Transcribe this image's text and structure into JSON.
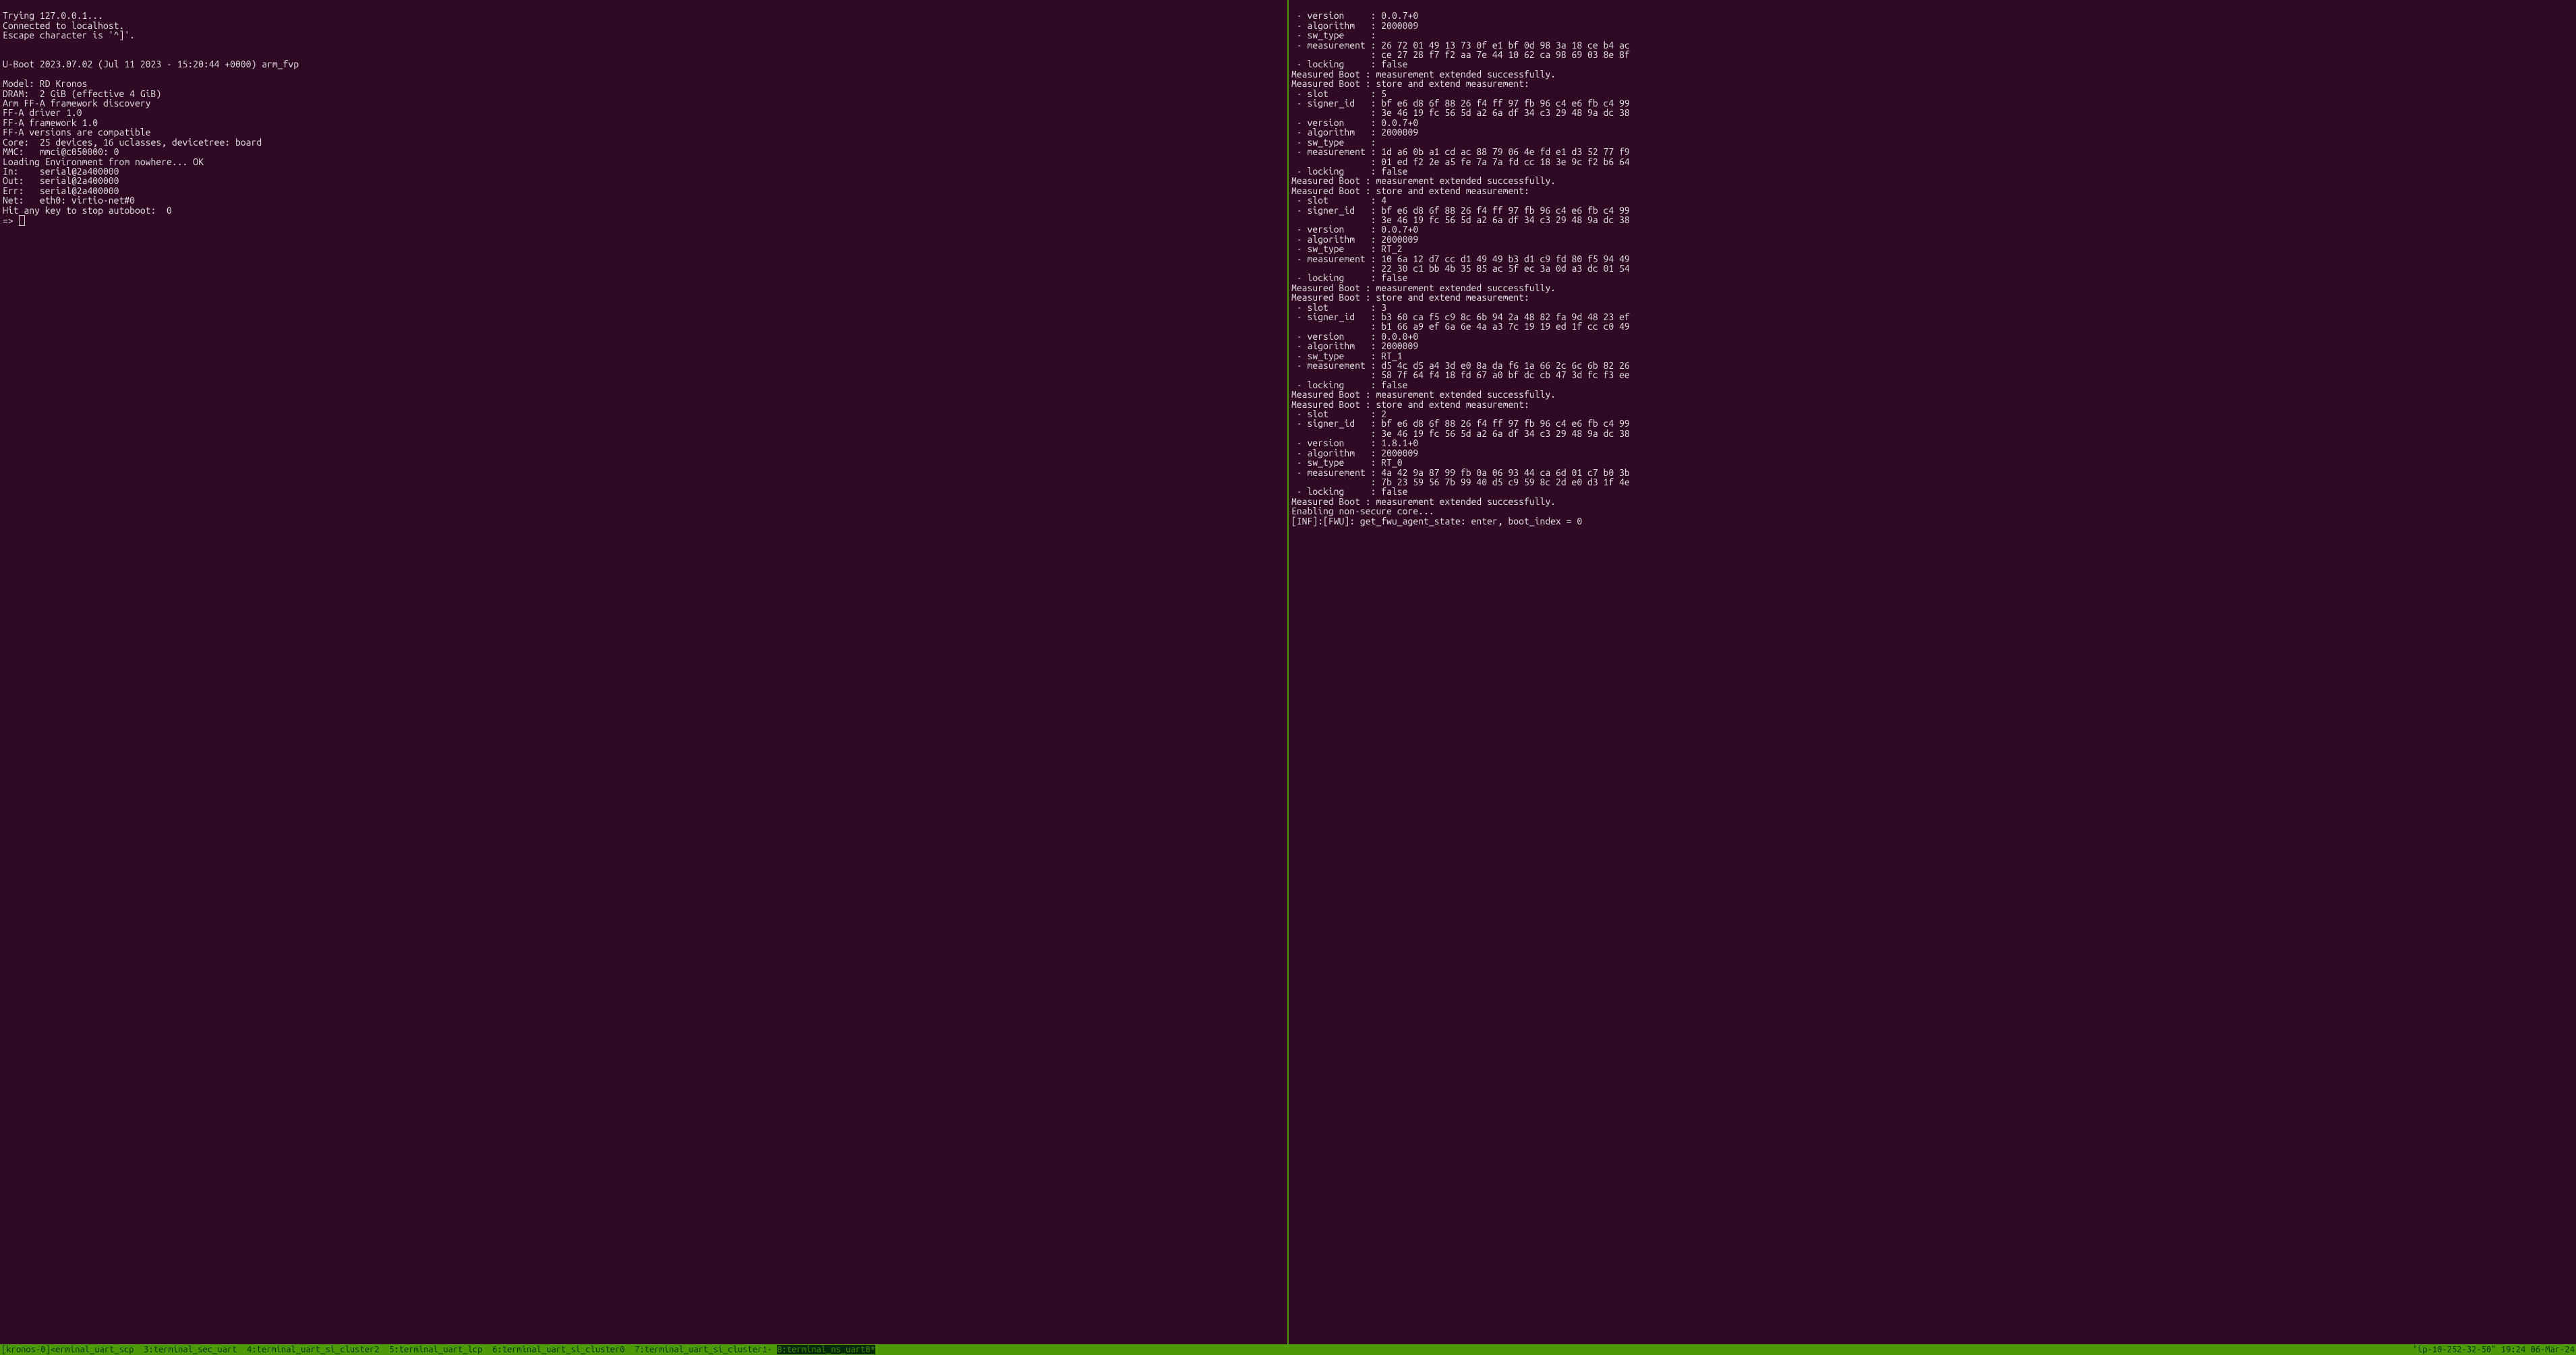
{
  "left_pane": {
    "lines": [
      "Trying 127.0.0.1...",
      "Connected to localhost.",
      "Escape character is '^]'.",
      "",
      "",
      "U-Boot 2023.07.02 (Jul 11 2023 - 15:20:44 +0000) arm_fvp",
      "",
      "Model: RD Kronos",
      "DRAM:  2 GiB (effective 4 GiB)",
      "Arm FF-A framework discovery",
      "FF-A driver 1.0",
      "FF-A framework 1.0",
      "FF-A versions are compatible",
      "Core:  25 devices, 16 uclasses, devicetree: board",
      "MMC:   mmci@c050000: 0",
      "Loading Environment from nowhere... OK",
      "In:    serial@2a400000",
      "Out:   serial@2a400000",
      "Err:   serial@2a400000",
      "Net:   eth0: virtio-net#0",
      "Hit any key to stop autoboot:  0"
    ],
    "prompt": "=> "
  },
  "right_pane": {
    "lines": [
      " - version     : 0.0.7+0",
      " - algorithm   : 2000009",
      " - sw_type     :",
      " - measurement : 26 72 01 49 13 73 0f e1 bf 0d 98 3a 18 ce b4 ac",
      "               : ce 27 28 f7 f2 aa 7e 44 10 62 ca 98 69 03 8e 8f",
      " - locking     : false",
      "Measured Boot : measurement extended successfully.",
      "Measured Boot : store and extend measurement:",
      " - slot        : 5",
      " - signer_id   : bf e6 d8 6f 88 26 f4 ff 97 fb 96 c4 e6 fb c4 99",
      "               : 3e 46 19 fc 56 5d a2 6a df 34 c3 29 48 9a dc 38",
      " - version     : 0.0.7+0",
      " - algorithm   : 2000009",
      " - sw_type     :",
      " - measurement : 1d a6 0b a1 cd ac 88 79 06 4e fd e1 d3 52 77 f9",
      "               : 01 ed f2 2e a5 fe 7a 7a fd cc 18 3e 9c f2 b6 64",
      " - locking     : false",
      "Measured Boot : measurement extended successfully.",
      "Measured Boot : store and extend measurement:",
      " - slot        : 4",
      " - signer_id   : bf e6 d8 6f 88 26 f4 ff 97 fb 96 c4 e6 fb c4 99",
      "               : 3e 46 19 fc 56 5d a2 6a df 34 c3 29 48 9a dc 38",
      " - version     : 0.0.7+0",
      " - algorithm   : 2000009",
      " - sw_type     : RT_2",
      " - measurement : 10 6a 12 d7 cc d1 49 49 b3 d1 c9 fd 80 f5 94 49",
      "               : 22 30 c1 bb 4b 35 85 ac 5f ec 3a 0d a3 dc 01 54",
      " - locking     : false",
      "Measured Boot : measurement extended successfully.",
      "Measured Boot : store and extend measurement:",
      " - slot        : 3",
      " - signer_id   : b3 60 ca f5 c9 8c 6b 94 2a 48 82 fa 9d 48 23 ef",
      "               : b1 66 a9 ef 6a 6e 4a a3 7c 19 19 ed 1f cc c0 49",
      " - version     : 0.0.0+0",
      " - algorithm   : 2000009",
      " - sw_type     : RT_1",
      " - measurement : d5 4c d5 a4 3d e0 8a da f6 1a 66 2c 6c 6b 82 26",
      "               : 58 7f 64 f4 18 fd 67 a0 bf dc cb 47 3d fc f3 ee",
      " - locking     : false",
      "Measured Boot : measurement extended successfully.",
      "Measured Boot : store and extend measurement:",
      " - slot        : 2",
      " - signer_id   : bf e6 d8 6f 88 26 f4 ff 97 fb 96 c4 e6 fb c4 99",
      "               : 3e 46 19 fc 56 5d a2 6a df 34 c3 29 48 9a dc 38",
      " - version     : 1.8.1+0",
      " - algorithm   : 2000009",
      " - sw_type     : RT_0",
      " - measurement : 4a 42 9a 87 99 fb 0a 06 93 44 ca 6d 01 c7 b0 3b",
      "               : 7b 23 59 56 7b 99 40 d5 c9 59 8c 2d e0 d3 1f 4e",
      " - locking     : false",
      "Measured Boot : measurement extended successfully.",
      "Enabling non-secure core...",
      "[INF]:[FWU]: get_fwu_agent_state: enter, boot_index = 0"
    ]
  },
  "statusbar": {
    "session": "[kronos-0]",
    "windows_text_before_active": "<erminal_uart_scp  3:terminal_sec_uart  4:terminal_uart_si_cluster2  5:terminal_uart_lcp  6:terminal_uart_si_cluster0  7:terminal_uart_si_cluster1- ",
    "active_window": "8:terminal_ns_uart0*",
    "host": "\"ip-10-252-32-50\"",
    "clock": "19:24 06-Mar-24"
  }
}
